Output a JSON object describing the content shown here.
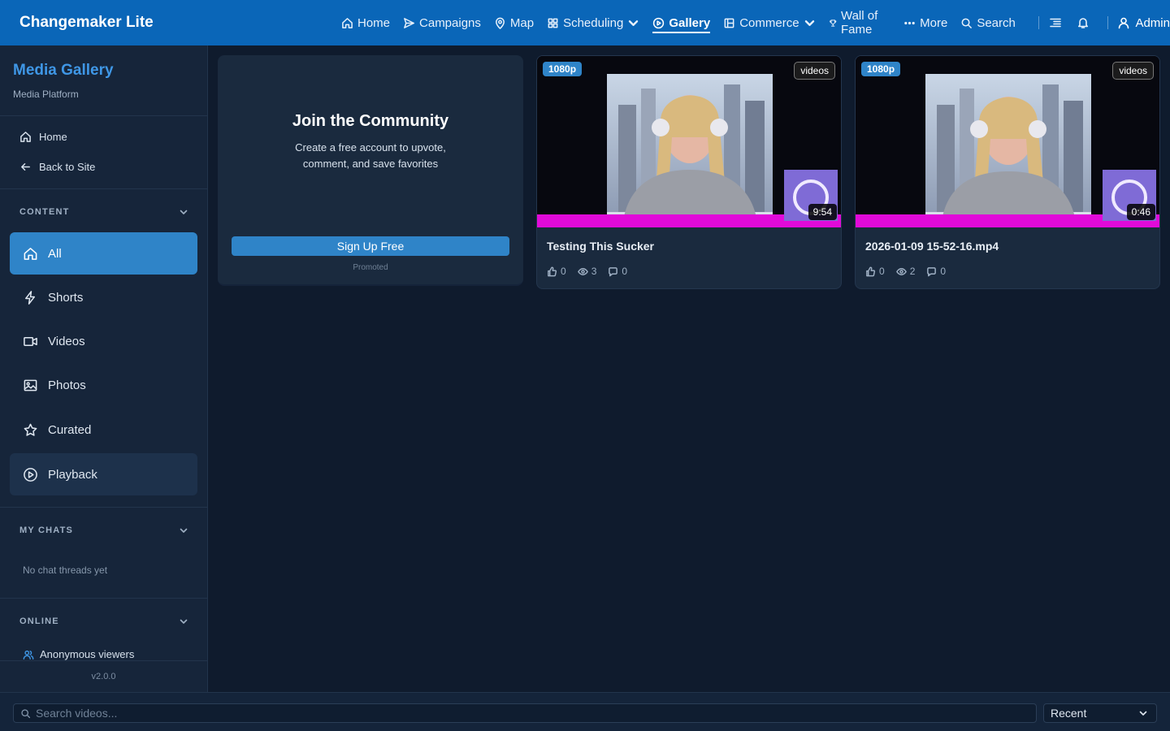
{
  "app": {
    "title": "Changemaker Lite"
  },
  "nav": {
    "items": [
      {
        "label": "Home",
        "icon": "home-icon"
      },
      {
        "label": "Campaigns",
        "icon": "send-icon"
      },
      {
        "label": "Map",
        "icon": "map-pin-icon"
      },
      {
        "label": "Scheduling",
        "icon": "grid-icon"
      },
      {
        "label": "Gallery",
        "icon": "play-circle-icon"
      },
      {
        "label": "Commerce",
        "icon": "store-icon"
      },
      {
        "label": "Wall of Fame",
        "icon": "trophy-icon"
      },
      {
        "label": "More",
        "icon": "ellipsis-icon"
      },
      {
        "label": "Search",
        "icon": "search-icon"
      }
    ],
    "active": "Gallery",
    "user": "Admin"
  },
  "sidebar": {
    "title": "Media Gallery",
    "subtitle": "Media Platform",
    "links": [
      {
        "label": "Home"
      },
      {
        "label": "Back to Site"
      }
    ],
    "content_heading": "CONTENT",
    "content_items": [
      {
        "label": "All"
      },
      {
        "label": "Shorts"
      },
      {
        "label": "Videos"
      },
      {
        "label": "Photos"
      },
      {
        "label": "Curated"
      },
      {
        "label": "Playback"
      }
    ],
    "chats_heading": "MY CHATS",
    "chats_empty": "No chat threads yet",
    "online_heading": "ONLINE",
    "online_label": "Anonymous viewers",
    "version": "v2.0.0"
  },
  "promo": {
    "title": "Join the Community",
    "text": "Create a free account to upvote, comment, and save favorites",
    "button": "Sign Up Free",
    "tag": "Promoted"
  },
  "videos": [
    {
      "title": "Testing This Sucker",
      "resolution": "1080p",
      "type": "videos",
      "duration": "9:54",
      "likes": "0",
      "views": "3",
      "comments": "0"
    },
    {
      "title": "2026-01-09 15-52-16.mp4",
      "resolution": "1080p",
      "type": "videos",
      "duration": "0:46",
      "likes": "0",
      "views": "2",
      "comments": "0"
    }
  ],
  "bottom": {
    "search_placeholder": "Search videos...",
    "sort": "Recent"
  },
  "colors": {
    "topbar": "#0a66b8",
    "accent": "#2f84c8",
    "sidebar_bg": "#16253a",
    "main_bg": "#0f1b2d",
    "card_bg": "#1a2a3e"
  }
}
